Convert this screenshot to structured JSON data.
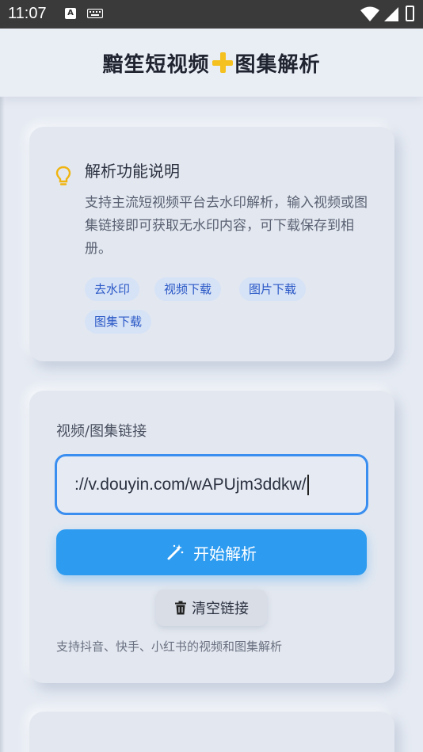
{
  "status": {
    "time": "11:07",
    "a_badge": "A"
  },
  "header": {
    "title_left": "黯笙短视频",
    "title_right": "图集解析",
    "plus_icon": "heavy-plus-emoji"
  },
  "info_card": {
    "title": "解析功能说明",
    "description": "支持主流短视频平台去水印解析，输入视频或图集链接即可获取无水印内容，可下载保存到相册。",
    "tags": [
      "去水印",
      "视频下载",
      "图片下载",
      "图集下载"
    ],
    "icon": "lightbulb-icon"
  },
  "parse_card": {
    "label": "视频/图集链接",
    "input_value": "://v.douyin.com/wAPUjm3ddkw/",
    "parse_button": "开始解析",
    "clear_button": "清空链接",
    "support_text": "支持抖音、快手、小红书的视频和图集解析"
  },
  "colors": {
    "accent": "#2d9bf0",
    "tag_bg": "#d6e2f6",
    "tag_text": "#2a58c6",
    "background": "#e6ebf3"
  }
}
